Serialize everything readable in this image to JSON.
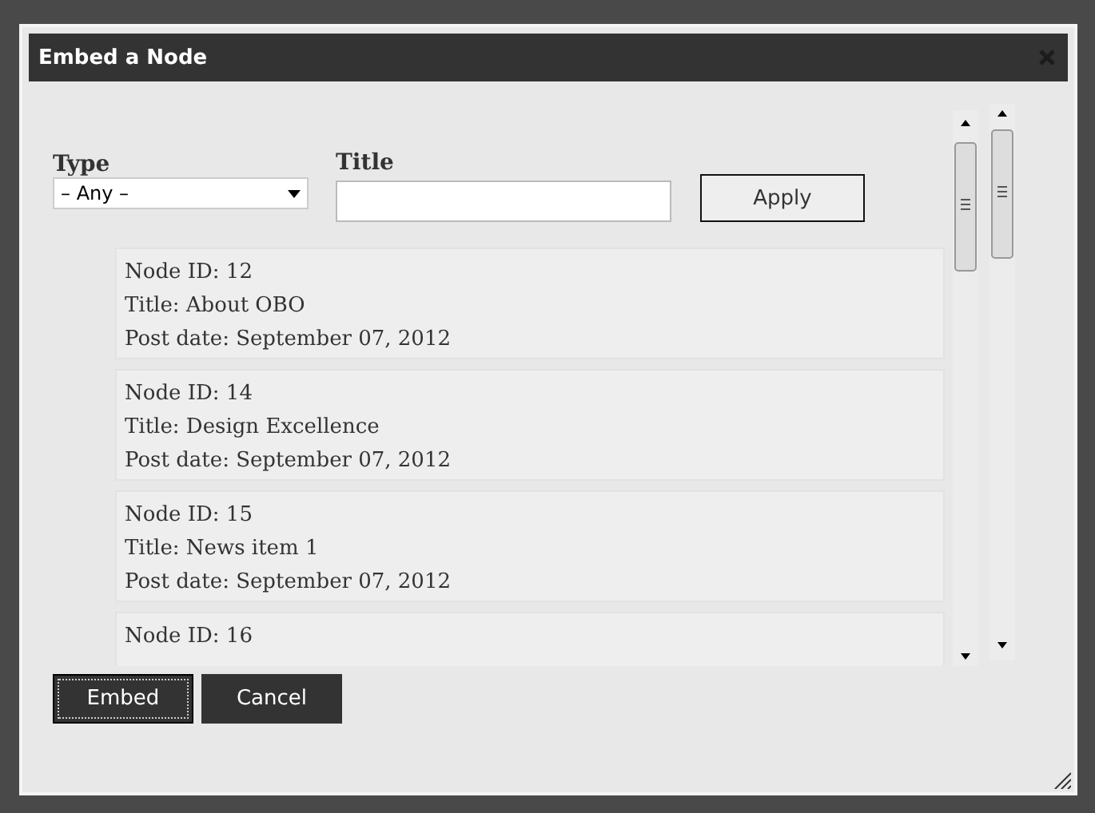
{
  "dialog": {
    "title": "Embed a Node"
  },
  "filters": {
    "type_label": "Type",
    "type_value": "– Any –",
    "title_label": "Title",
    "apply": "Apply"
  },
  "results": [
    {
      "lines": [
        "Node ID: 12",
        "Title: About OBO",
        "Post date: September 07, 2012"
      ]
    },
    {
      "lines": [
        "Node ID: 14",
        "Title: Design Excellence",
        "Post date: September 07, 2012"
      ]
    },
    {
      "lines": [
        "Node ID: 15",
        "Title: News item 1",
        "Post date: September 07, 2012"
      ]
    },
    {
      "lines": [
        "Node ID: 16"
      ]
    }
  ],
  "buttons": [
    {
      "label": "Embed",
      "focused": true
    },
    {
      "label": "Cancel",
      "focused": false
    }
  ]
}
